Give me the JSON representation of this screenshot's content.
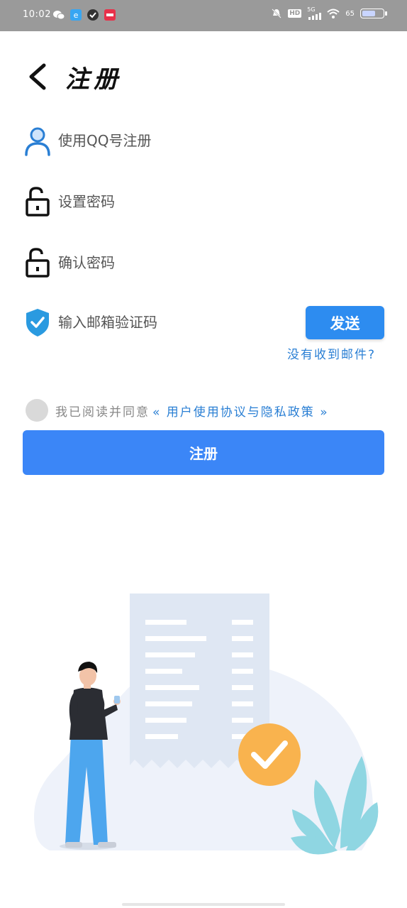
{
  "status_bar": {
    "time": "10:02",
    "network": "5G",
    "hd": "HD",
    "battery_percent": "65",
    "battery_level": 0.65
  },
  "header": {
    "back_icon": "chevron-left-icon",
    "title": "注册"
  },
  "form": {
    "qq_placeholder": "使用QQ号注册",
    "password_placeholder": "设置密码",
    "confirm_placeholder": "确认密码",
    "code_placeholder": "输入邮箱验证码",
    "send_label": "发送",
    "not_received": "没有收到邮件?",
    "agree_text": "我已阅读并同意",
    "agree_link": "« 用户使用协议与隐私政策 »",
    "register_label": "注册"
  },
  "colors": {
    "primary": "#3b86f7",
    "send": "#2d8cf0",
    "link": "#2a7fd4",
    "status_bar": "#9a9a9a"
  }
}
